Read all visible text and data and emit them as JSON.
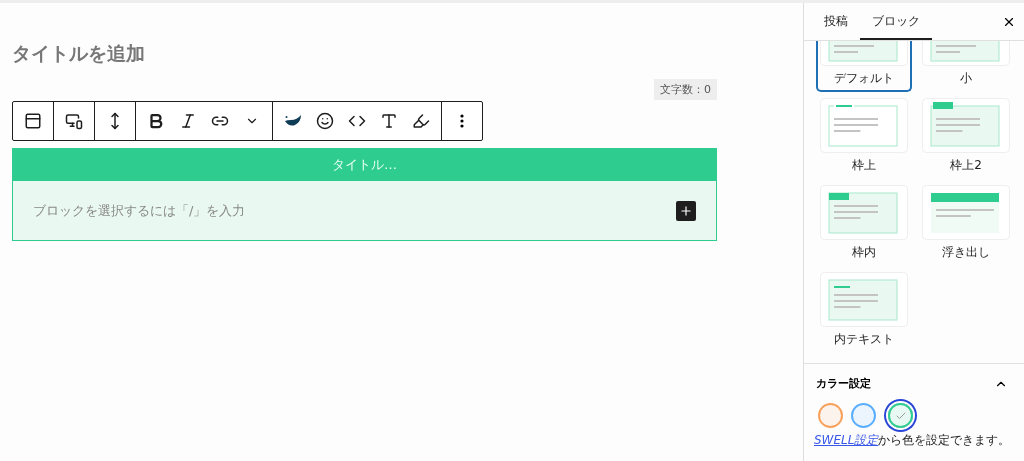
{
  "editor": {
    "title_placeholder": "タイトルを追加",
    "char_count": "文字数：0",
    "toolbar": [
      [
        {
          "kind": "block-type"
        }
      ],
      [
        {
          "kind": "device"
        }
      ],
      [
        {
          "kind": "spacing"
        }
      ],
      [
        {
          "kind": "bold"
        },
        {
          "kind": "italic"
        },
        {
          "kind": "link"
        },
        {
          "kind": "more"
        }
      ],
      [
        {
          "kind": "swell"
        },
        {
          "kind": "emoji"
        },
        {
          "kind": "code"
        },
        {
          "kind": "font-size"
        },
        {
          "kind": "highlight"
        }
      ],
      [
        {
          "kind": "options"
        }
      ]
    ],
    "block": {
      "title": "タイトル…",
      "placeholder": "ブロックを選択するには「/」を入力"
    }
  },
  "sidebar": {
    "tabs": [
      {
        "label": "投稿",
        "selected": false
      },
      {
        "label": "ブロック",
        "selected": true
      }
    ],
    "styles": [
      {
        "kind": "default",
        "label": "デフォルト",
        "selected": true
      },
      {
        "kind": "small",
        "label": "小",
        "selected": false
      },
      {
        "kind": "frame-top",
        "label": "枠上",
        "selected": false
      },
      {
        "kind": "frame-top2",
        "label": "枠上2",
        "selected": false
      },
      {
        "kind": "frame-inner",
        "label": "枠内",
        "selected": false
      },
      {
        "kind": "float",
        "label": "浮き出し",
        "selected": false
      },
      {
        "kind": "inner-text",
        "label": "内テキスト",
        "selected": false
      }
    ],
    "color_panel": {
      "title": "カラー設定",
      "expanded": true,
      "colors": [
        {
          "color": "#f7a15b",
          "selected": false
        },
        {
          "color": "#5aaeff",
          "selected": false
        },
        {
          "color": "#2ecc8f",
          "selected": true
        }
      ],
      "note_link": "SWELL設定",
      "note": "から色を設定できます。"
    }
  }
}
